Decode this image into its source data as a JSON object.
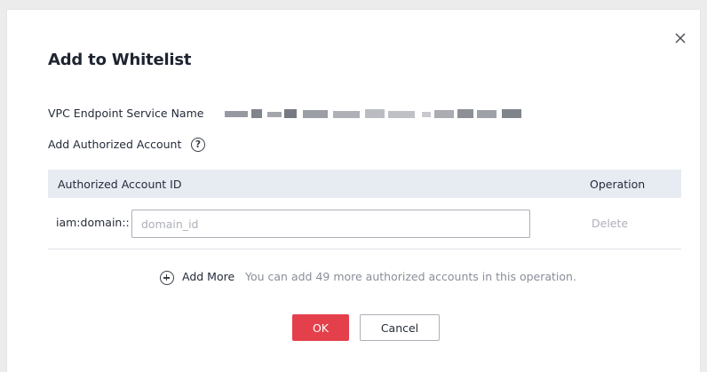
{
  "dialog": {
    "title": "Add to Whitelist",
    "close_icon": "close-icon",
    "service_name_label": "VPC Endpoint Service Name",
    "add_account_label": "Add Authorized Account",
    "help_icon_glyph": "?",
    "table": {
      "columns": [
        "Authorized Account ID",
        "Operation"
      ],
      "rows": [
        {
          "prefix": "iam:domain::",
          "value": "",
          "placeholder": "domain_id",
          "action": "Delete"
        }
      ]
    },
    "add_more_label": "Add More",
    "add_more_hint": "You can add 49 more authorized accounts in this operation.",
    "ok_label": "OK",
    "cancel_label": "Cancel"
  },
  "colors": {
    "primary_button": "#e4404c",
    "table_header_bg": "#e7ebf2",
    "muted_text": "#adb0b8"
  }
}
